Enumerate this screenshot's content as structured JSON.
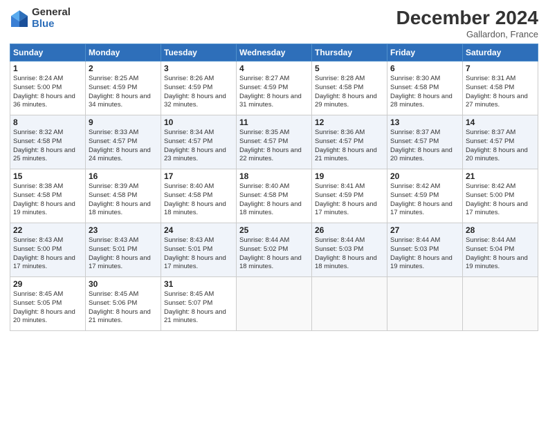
{
  "header": {
    "logo_general": "General",
    "logo_blue": "Blue",
    "title": "December 2024",
    "location": "Gallardon, France"
  },
  "days_of_week": [
    "Sunday",
    "Monday",
    "Tuesday",
    "Wednesday",
    "Thursday",
    "Friday",
    "Saturday"
  ],
  "weeks": [
    [
      {
        "day": "1",
        "sunrise": "8:24 AM",
        "sunset": "5:00 PM",
        "daylight": "8 hours and 36 minutes."
      },
      {
        "day": "2",
        "sunrise": "8:25 AM",
        "sunset": "4:59 PM",
        "daylight": "8 hours and 34 minutes."
      },
      {
        "day": "3",
        "sunrise": "8:26 AM",
        "sunset": "4:59 PM",
        "daylight": "8 hours and 32 minutes."
      },
      {
        "day": "4",
        "sunrise": "8:27 AM",
        "sunset": "4:59 PM",
        "daylight": "8 hours and 31 minutes."
      },
      {
        "day": "5",
        "sunrise": "8:28 AM",
        "sunset": "4:58 PM",
        "daylight": "8 hours and 29 minutes."
      },
      {
        "day": "6",
        "sunrise": "8:30 AM",
        "sunset": "4:58 PM",
        "daylight": "8 hours and 28 minutes."
      },
      {
        "day": "7",
        "sunrise": "8:31 AM",
        "sunset": "4:58 PM",
        "daylight": "8 hours and 27 minutes."
      }
    ],
    [
      {
        "day": "8",
        "sunrise": "8:32 AM",
        "sunset": "4:58 PM",
        "daylight": "8 hours and 25 minutes."
      },
      {
        "day": "9",
        "sunrise": "8:33 AM",
        "sunset": "4:57 PM",
        "daylight": "8 hours and 24 minutes."
      },
      {
        "day": "10",
        "sunrise": "8:34 AM",
        "sunset": "4:57 PM",
        "daylight": "8 hours and 23 minutes."
      },
      {
        "day": "11",
        "sunrise": "8:35 AM",
        "sunset": "4:57 PM",
        "daylight": "8 hours and 22 minutes."
      },
      {
        "day": "12",
        "sunrise": "8:36 AM",
        "sunset": "4:57 PM",
        "daylight": "8 hours and 21 minutes."
      },
      {
        "day": "13",
        "sunrise": "8:37 AM",
        "sunset": "4:57 PM",
        "daylight": "8 hours and 20 minutes."
      },
      {
        "day": "14",
        "sunrise": "8:37 AM",
        "sunset": "4:57 PM",
        "daylight": "8 hours and 20 minutes."
      }
    ],
    [
      {
        "day": "15",
        "sunrise": "8:38 AM",
        "sunset": "4:58 PM",
        "daylight": "8 hours and 19 minutes."
      },
      {
        "day": "16",
        "sunrise": "8:39 AM",
        "sunset": "4:58 PM",
        "daylight": "8 hours and 18 minutes."
      },
      {
        "day": "17",
        "sunrise": "8:40 AM",
        "sunset": "4:58 PM",
        "daylight": "8 hours and 18 minutes."
      },
      {
        "day": "18",
        "sunrise": "8:40 AM",
        "sunset": "4:58 PM",
        "daylight": "8 hours and 18 minutes."
      },
      {
        "day": "19",
        "sunrise": "8:41 AM",
        "sunset": "4:59 PM",
        "daylight": "8 hours and 17 minutes."
      },
      {
        "day": "20",
        "sunrise": "8:42 AM",
        "sunset": "4:59 PM",
        "daylight": "8 hours and 17 minutes."
      },
      {
        "day": "21",
        "sunrise": "8:42 AM",
        "sunset": "5:00 PM",
        "daylight": "8 hours and 17 minutes."
      }
    ],
    [
      {
        "day": "22",
        "sunrise": "8:43 AM",
        "sunset": "5:00 PM",
        "daylight": "8 hours and 17 minutes."
      },
      {
        "day": "23",
        "sunrise": "8:43 AM",
        "sunset": "5:01 PM",
        "daylight": "8 hours and 17 minutes."
      },
      {
        "day": "24",
        "sunrise": "8:43 AM",
        "sunset": "5:01 PM",
        "daylight": "8 hours and 17 minutes."
      },
      {
        "day": "25",
        "sunrise": "8:44 AM",
        "sunset": "5:02 PM",
        "daylight": "8 hours and 18 minutes."
      },
      {
        "day": "26",
        "sunrise": "8:44 AM",
        "sunset": "5:03 PM",
        "daylight": "8 hours and 18 minutes."
      },
      {
        "day": "27",
        "sunrise": "8:44 AM",
        "sunset": "5:03 PM",
        "daylight": "8 hours and 19 minutes."
      },
      {
        "day": "28",
        "sunrise": "8:44 AM",
        "sunset": "5:04 PM",
        "daylight": "8 hours and 19 minutes."
      }
    ],
    [
      {
        "day": "29",
        "sunrise": "8:45 AM",
        "sunset": "5:05 PM",
        "daylight": "8 hours and 20 minutes."
      },
      {
        "day": "30",
        "sunrise": "8:45 AM",
        "sunset": "5:06 PM",
        "daylight": "8 hours and 21 minutes."
      },
      {
        "day": "31",
        "sunrise": "8:45 AM",
        "sunset": "5:07 PM",
        "daylight": "8 hours and 21 minutes."
      },
      null,
      null,
      null,
      null
    ]
  ]
}
